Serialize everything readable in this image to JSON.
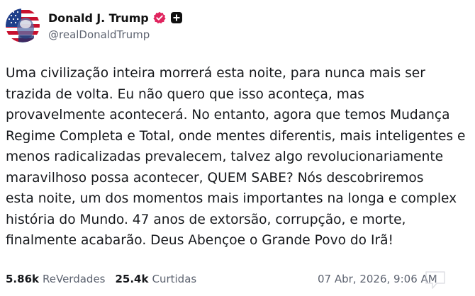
{
  "author": {
    "display_name": "Donald J. Trump",
    "handle": "@realDonaldTrump",
    "avatar_icon": "flag-portrait-avatar",
    "badges": [
      "verified-badge-icon",
      "plus-badge-icon"
    ]
  },
  "post": {
    "lines": [
      "Uma civilização inteira morrerá esta noite, para nunca mais ser",
      "trazida de volta. Eu não quero que isso aconteça, mas",
      "provavelmente acontecerá. No entanto, agora que temos Mudança",
      "Regime Completa e Total, onde mentes diferentis, mais inteligentes e",
      "menos radicalizadas prevalecem, talvez algo revolucionariamente",
      "maravilhoso possa acontecer, QUEM SABE? Nós descobriremos",
      "esta noite, um dos momentos mais importantes na longa e complex",
      "história do Mundo. 47 anos de extorsão, corrupção, e morte,",
      "finalmente acabarão. Deus Abençoe o Grande Povo do Irã!"
    ]
  },
  "stats": {
    "reposts_count": "5.86k",
    "reposts_label": "ReVerdades",
    "likes_count": "25.4k",
    "likes_label": "Curtidas"
  },
  "timestamp": "07 Abr, 2026, 9:06 AM",
  "colors": {
    "verified_badge": "#e0245e",
    "text_primary": "#16181c",
    "text_secondary": "#5d6370"
  }
}
